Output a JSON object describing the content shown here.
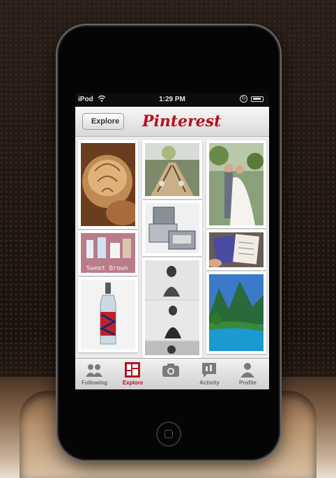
{
  "status_bar": {
    "carrier": "iPod",
    "time": "1:29 PM"
  },
  "nav": {
    "back_label": "Explore",
    "logo_text": "Pinterest"
  },
  "pins": [
    {
      "subject": "bread loaves"
    },
    {
      "subject": "banquet table"
    },
    {
      "subject": "wedding couple"
    },
    {
      "subject": "baby travel bag"
    },
    {
      "subject": "baking ingredients with caption",
      "caption": "Sweet Brown Bread"
    },
    {
      "subject": "pregnancy photos"
    },
    {
      "subject": "notebook in hands"
    },
    {
      "subject": "decorated bottle"
    },
    {
      "subject": "tropical pool"
    }
  ],
  "tab_bar": {
    "tabs": [
      {
        "label": "Following",
        "icon": "people-icon",
        "active": false
      },
      {
        "label": "Explore",
        "icon": "explore-grid-icon",
        "active": true
      },
      {
        "label": "",
        "icon": "camera-icon",
        "active": false
      },
      {
        "label": "Activity",
        "icon": "activity-icon",
        "active": false
      },
      {
        "label": "Profile",
        "icon": "person-icon",
        "active": false
      }
    ]
  },
  "colors": {
    "brand_red": "#b5131e",
    "tab_inactive": "#6b6b6b"
  }
}
